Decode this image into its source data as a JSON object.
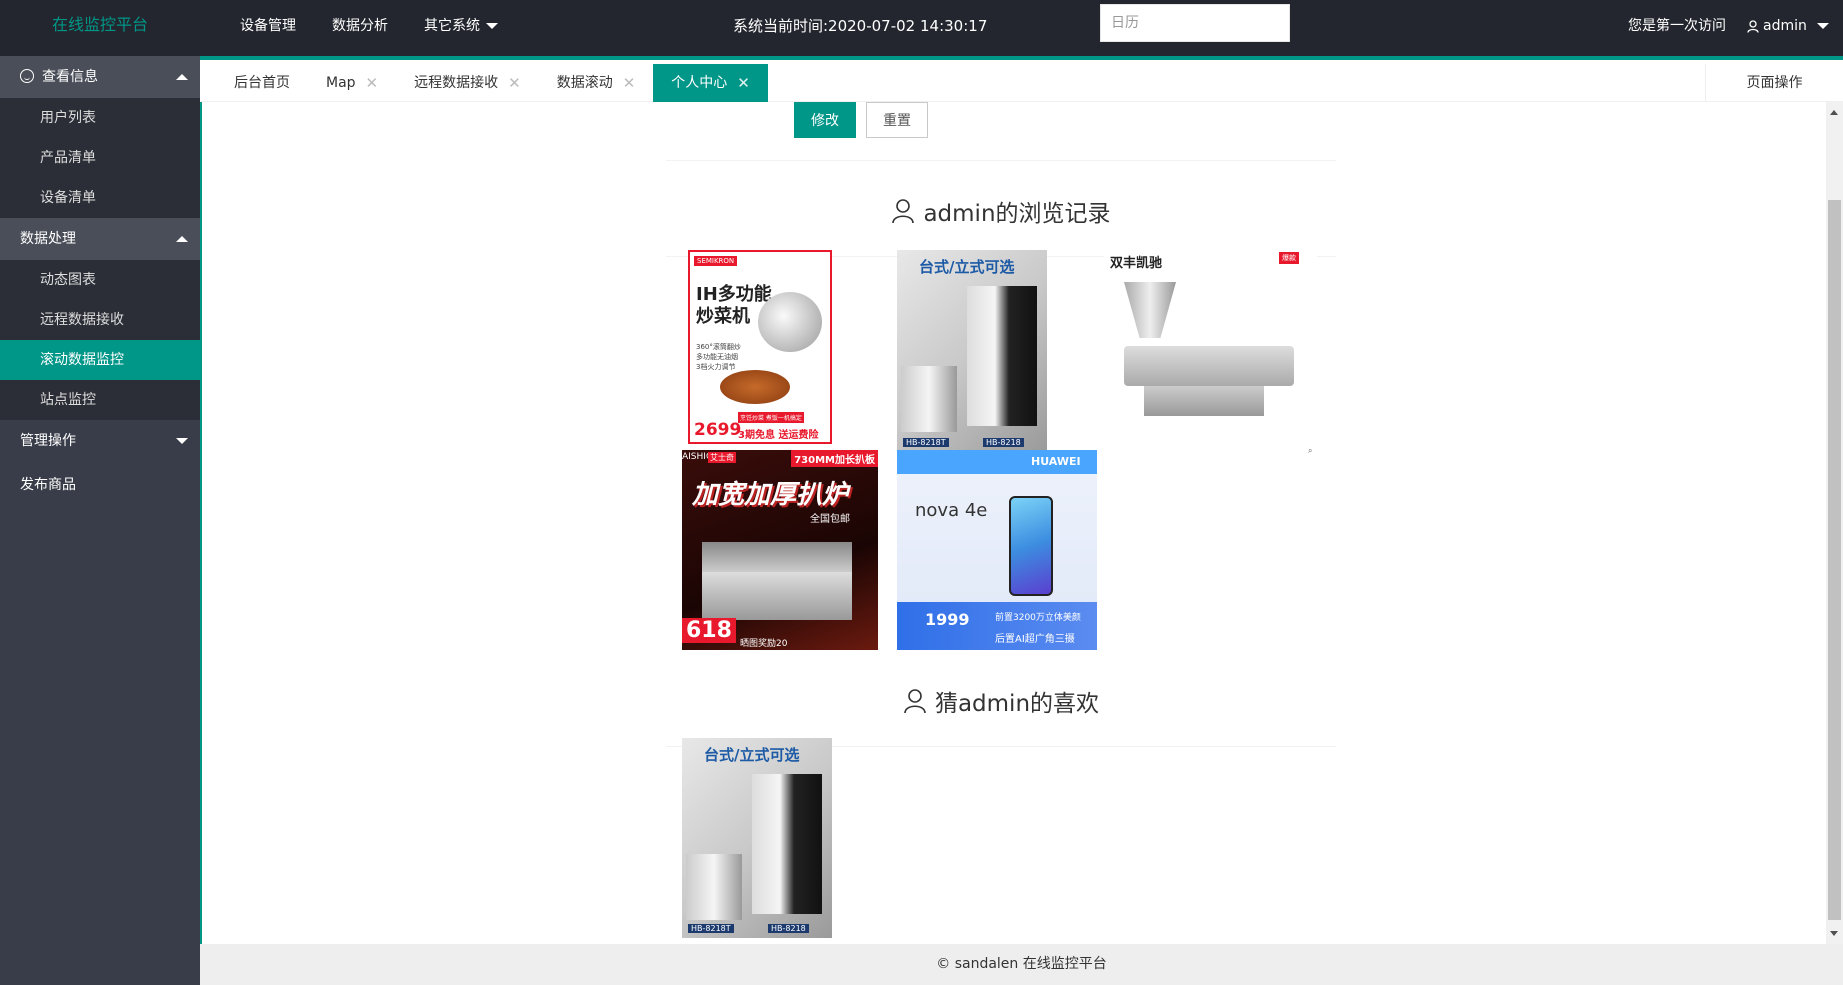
{
  "header": {
    "logo": "在线监控平台",
    "nav": [
      "设备管理",
      "数据分析",
      "其它系统"
    ],
    "clock": "系统当前时间:2020-07-02 14:30:17",
    "calendar_placeholder": "日历",
    "first_visit": "您是第一次访问",
    "user": "admin"
  },
  "sidebar": {
    "groups": [
      {
        "label": "查看信息",
        "items": [
          "用户列表",
          "产品清单",
          "设备清单"
        ]
      },
      {
        "label": "数据处理",
        "items": [
          "动态图表",
          "远程数据接收",
          "滚动数据监控",
          "站点监控"
        ]
      },
      {
        "label": "管理操作"
      },
      {
        "label": "发布商品"
      }
    ]
  },
  "tabs": {
    "items": [
      "后台首页",
      "Map",
      "远程数据接收",
      "数据滚动",
      "个人中心"
    ],
    "page_ops": "页面操作"
  },
  "form": {
    "submit": "修改",
    "reset": "重置"
  },
  "history": {
    "title": "admin的浏览记录",
    "items": [
      {
        "line1": "IH多功能",
        "line2": "炒菜机",
        "brand": "SEMIKRON",
        "feat1": "360°滚筒翻炒",
        "feat2": "多功能无油烟",
        "feat3": "3档火力调节",
        "price": "2699",
        "promo": "3期免息 送运费险",
        "badge": "烹饪炒菜 煮饭一机搞定"
      },
      {
        "caption": "台式/立式可选",
        "model1": "HB-8218T",
        "model2": "HB-8218"
      },
      {
        "caption": "双丰凯驰",
        "tag": "爆款"
      },
      {
        "brand": "AISHIQI",
        "brand2": "艾士奇",
        "spec": "730MM加长扒板",
        "title": "加宽加厚扒炉",
        "sub": "全国包邮",
        "price": "618",
        "note": "晒图奖励20"
      },
      {
        "brand": "HUAWEI",
        "model": "nova 4e",
        "price": "1999",
        "promo1": "前置3200万立体美颜",
        "promo2": "后置AI超广角三摄"
      }
    ]
  },
  "guess": {
    "title": "猜admin的喜欢",
    "items": [
      {
        "caption": "台式/立式可选",
        "model1": "HB-8218T",
        "model2": "HB-8218"
      }
    ]
  },
  "footer": "© sandalen 在线监控平台",
  "colors": {
    "accent": "#009688",
    "header_bg": "#23262e",
    "sidebar_bg": "#393d49",
    "sidebar_sub_bg": "#2b2e37"
  }
}
